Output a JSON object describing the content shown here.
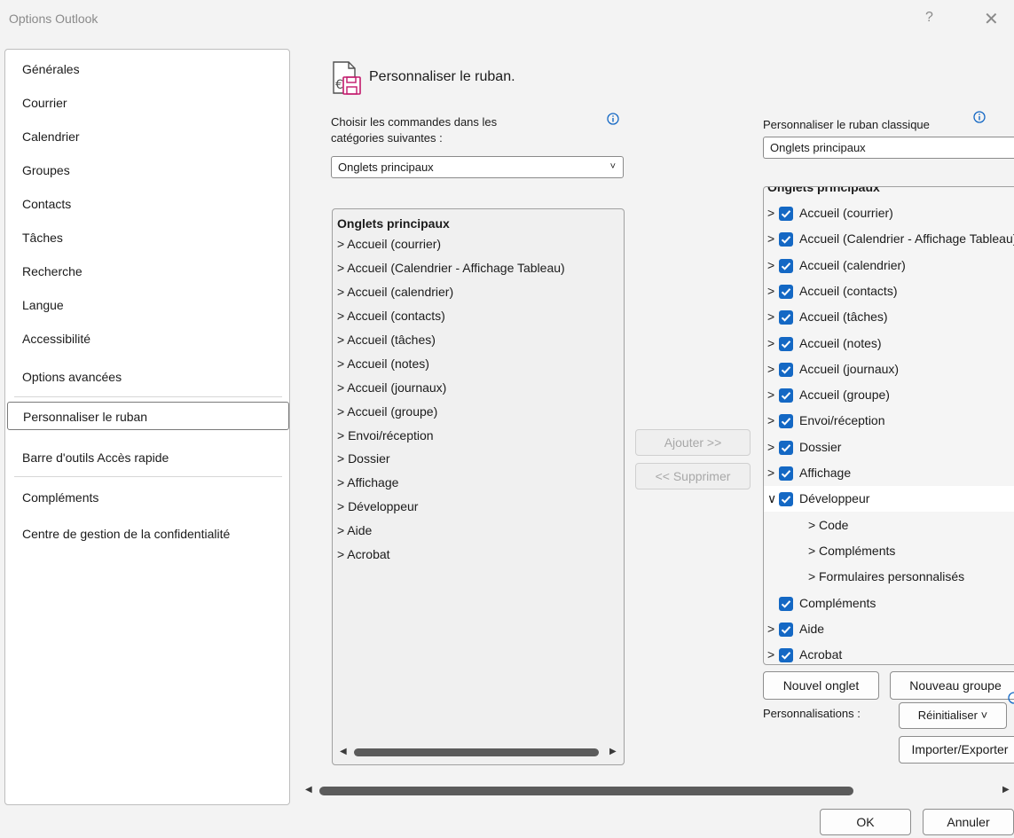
{
  "window": {
    "title": "Options Outlook",
    "help_label": "?",
    "close_label": "✕"
  },
  "nav": {
    "items": [
      {
        "label": "Générales"
      },
      {
        "label": "Courrier"
      },
      {
        "label": "Calendrier"
      },
      {
        "label": "Groupes"
      },
      {
        "label": "Contacts"
      },
      {
        "label": "Tâches"
      },
      {
        "label": "Recherche"
      },
      {
        "label": "Langue"
      },
      {
        "label": "Accessibilité"
      },
      {
        "label": "Options avancées"
      },
      {
        "label": "Personnaliser le ruban",
        "selected": true
      },
      {
        "label": "Barre d'outils Accès rapide"
      },
      {
        "label": "Compléments"
      },
      {
        "label": "Centre de gestion de la confidentialité"
      }
    ]
  },
  "header": {
    "title": "Personnaliser le ruban.",
    "icon": "customize-ribbon-icon"
  },
  "left_panel": {
    "label_line1": "Choisir les commandes dans les",
    "label_line2": "catégories suivantes :",
    "dropdown_value": "Onglets principaux",
    "list_header": "Onglets principaux",
    "items": [
      "> Accueil (courrier)",
      "> Accueil (Calendrier - Affichage Tableau)",
      "> Accueil (calendrier)",
      "> Accueil (contacts)",
      "> Accueil (tâches)",
      "> Accueil (notes)",
      "> Accueil (journaux)",
      "> Accueil (groupe)",
      "> Envoi/réception",
      "> Dossier",
      "> Affichage",
      "> Développeur",
      "> Aide",
      "> Acrobat"
    ]
  },
  "middle": {
    "add_label": "Ajouter >>",
    "remove_label": "<< Supprimer"
  },
  "right_panel": {
    "label": "Personnaliser le ruban classique",
    "dropdown_value": "Onglets principaux",
    "tree_header": "Onglets principaux",
    "items": [
      {
        "label": "Accueil (courrier)",
        "expander": ">",
        "checked": true,
        "level": 0
      },
      {
        "label": "Accueil (Calendrier - Affichage Tableau)",
        "expander": ">",
        "checked": true,
        "level": 0
      },
      {
        "label": "Accueil (calendrier)",
        "expander": ">",
        "checked": true,
        "level": 0
      },
      {
        "label": "Accueil (contacts)",
        "expander": ">",
        "checked": true,
        "level": 0
      },
      {
        "label": "Accueil (tâches)",
        "expander": ">",
        "checked": true,
        "level": 0
      },
      {
        "label": "Accueil (notes)",
        "expander": ">",
        "checked": true,
        "level": 0
      },
      {
        "label": "Accueil (journaux)",
        "expander": ">",
        "checked": true,
        "level": 0
      },
      {
        "label": "Accueil (groupe)",
        "expander": ">",
        "checked": true,
        "level": 0
      },
      {
        "label": "Envoi/réception",
        "expander": ">",
        "checked": true,
        "level": 0
      },
      {
        "label": "Dossier",
        "expander": ">",
        "checked": true,
        "level": 0
      },
      {
        "label": "Affichage",
        "expander": ">",
        "checked": true,
        "level": 0
      },
      {
        "label": "Développeur",
        "expander": "v",
        "checked": true,
        "level": 0,
        "highlighted": true
      },
      {
        "label": "Code",
        "expander": ">",
        "checked": false,
        "level": 1
      },
      {
        "label": "Compléments",
        "expander": ">",
        "checked": false,
        "level": 1
      },
      {
        "label": "Formulaires personnalisés",
        "expander": ">",
        "checked": false,
        "level": 1
      },
      {
        "label": "Compléments",
        "expander": "",
        "checked": true,
        "level": 0
      },
      {
        "label": "Aide",
        "expander": ">",
        "checked": true,
        "level": 0
      },
      {
        "label": "Acrobat",
        "expander": ">",
        "checked": true,
        "level": 0
      }
    ],
    "new_tab_label": "Nouvel onglet",
    "new_group_label": "Nouveau groupe",
    "customizations_label": "Personnalisations :",
    "reset_label": "Réinitialiser ˅",
    "import_export_label": "Importer/Exporter"
  },
  "footer": {
    "ok_label": "OK",
    "cancel_label": "Annuler"
  },
  "colors": {
    "accent": "#1468c4",
    "background": "#f3f3f3"
  }
}
